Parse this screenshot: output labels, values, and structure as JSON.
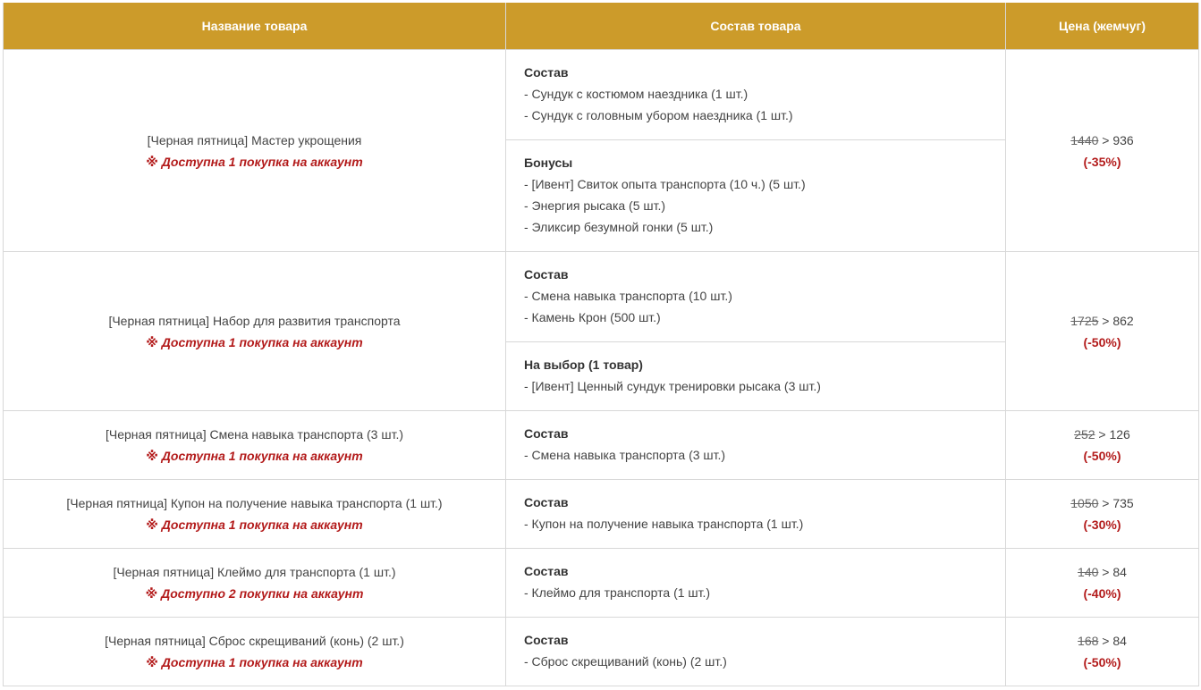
{
  "header": {
    "col_name": "Название товара",
    "col_composition": "Состав товара",
    "col_price": "Цена (жемчуг)"
  },
  "rows": [
    {
      "name": "[Черная пятница] Мастер укрощения",
      "limit": "※ Доступна 1 покупка на аккаунт",
      "sections": [
        {
          "title": "Состав",
          "items": [
            "- Сундук с костюмом наездника (1 шт.)",
            "- Сундук с головным убором наездника (1 шт.)"
          ]
        },
        {
          "title": "Бонусы",
          "items": [
            "- [Ивент] Свиток опыта транспорта (10 ч.) (5 шт.)",
            "- Энергия рысака (5 шт.)",
            "- Эликсир безумной гонки (5 шт.)"
          ]
        }
      ],
      "price_old": "1440",
      "price_new": " > 936",
      "discount": "(-35%)"
    },
    {
      "name": "[Черная пятница] Набор для развития транспорта",
      "limit": "※ Доступна 1 покупка на аккаунт",
      "sections": [
        {
          "title": "Состав",
          "items": [
            "- Смена навыка транспорта (10 шт.)",
            "- Камень Крон (500 шт.)"
          ]
        },
        {
          "title": "На выбор (1 товар)",
          "items": [
            "- [Ивент] Ценный сундук тренировки рысака (3 шт.)"
          ]
        }
      ],
      "price_old": "1725",
      "price_new": " > 862",
      "discount": "(-50%)"
    },
    {
      "name": "[Черная пятница] Смена навыка транспорта (3 шт.)",
      "limit": "※ Доступна 1 покупка на аккаунт",
      "sections": [
        {
          "title": "Состав",
          "items": [
            "- Смена навыка транспорта (3 шт.)"
          ]
        }
      ],
      "price_old": "252",
      "price_new": " > 126",
      "discount": "(-50%)"
    },
    {
      "name": "[Черная пятница] Купон на получение навыка транспорта (1 шт.)",
      "limit": "※ Доступна 1 покупка на аккаунт",
      "sections": [
        {
          "title": "Состав",
          "items": [
            "- Купон на получение навыка транспорта (1 шт.)"
          ]
        }
      ],
      "price_old": "1050",
      "price_new": " > 735",
      "discount": "(-30%)"
    },
    {
      "name": "[Черная пятница] Клеймо для транспорта (1 шт.)",
      "limit": "※ Доступно 2 покупки на аккаунт",
      "sections": [
        {
          "title": "Состав",
          "items": [
            "- Клеймо для транспорта (1 шт.)"
          ]
        }
      ],
      "price_old": "140",
      "price_new": " > 84",
      "discount": "(-40%)"
    },
    {
      "name": "[Черная пятница] Сброс скрещиваний (конь) (2 шт.)",
      "limit": "※ Доступна 1 покупка на аккаунт",
      "sections": [
        {
          "title": "Состав",
          "items": [
            "- Сброс скрещиваний (конь) (2 шт.)"
          ]
        }
      ],
      "price_old": "168",
      "price_new": " > 84",
      "discount": "(-50%)"
    }
  ]
}
